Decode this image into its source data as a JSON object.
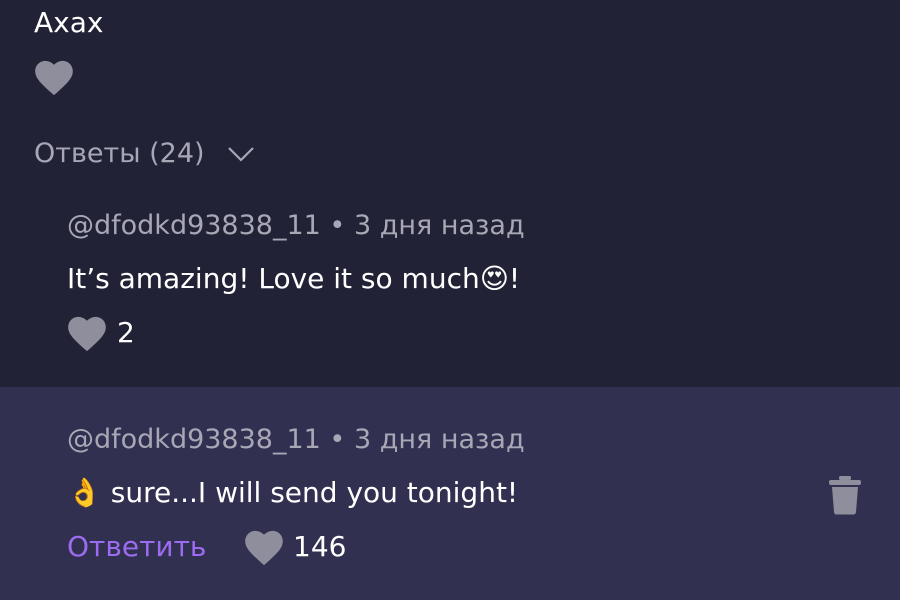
{
  "parent_comment": {
    "text": "Ахах"
  },
  "replies_toggle": {
    "label": "Ответы (24)"
  },
  "reply_1": {
    "author": "@dfodkd93838_11",
    "separator": "•",
    "time": "3 дня назад",
    "text": "It’s amazing! Love it so much😍!",
    "likes": "2"
  },
  "reply_2": {
    "author": "@dfodkd93838_11",
    "separator": "•",
    "time": "3 дня назад",
    "text": "👌 sure...I will send you tonight!",
    "reply_label": "Ответить",
    "likes": "146"
  },
  "colors": {
    "background": "#222236",
    "highlight": "#313050",
    "accent": "#9b6cf0",
    "muted": "#a7a7b6",
    "icon": "#8e8e9c"
  },
  "icons": {
    "like": "heart-icon",
    "expand": "chevron-down-icon",
    "delete": "trash-icon"
  }
}
